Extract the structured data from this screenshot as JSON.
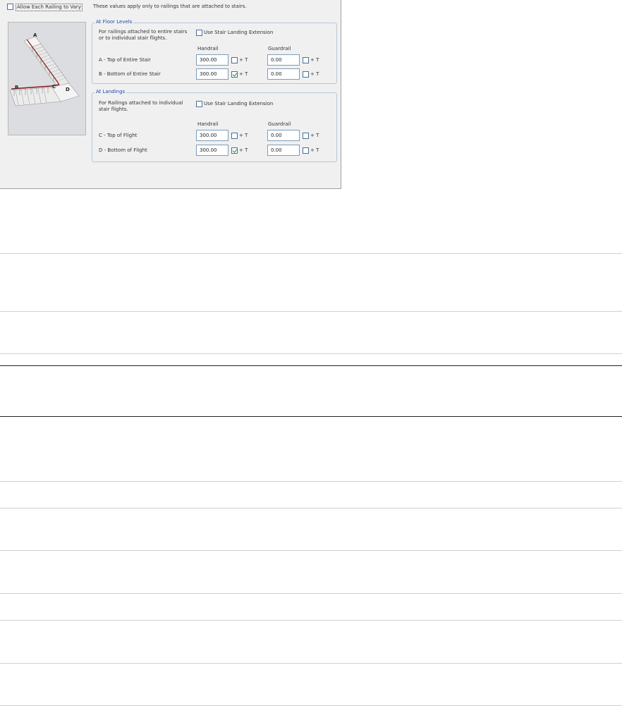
{
  "dialog": {
    "allow_vary_label": "Allow Each Railing to Vary",
    "note": "These values apply only to railings that are attached to stairs.",
    "floor_levels": {
      "title": "At Floor Levels",
      "description": "For railings attached to entire stairs or to individual stair flights.",
      "extension_label": "Use Stair Landing Extension",
      "handrail_header": "Handrail",
      "guardrail_header": "Guardrail",
      "rows": [
        {
          "label": "A - Top of Entire Stair",
          "handrail": "300.00",
          "guardrail": "0.00",
          "handrail_t_checked": false,
          "guardrail_t_checked": false
        },
        {
          "label": "B - Bottom of Entire Stair",
          "handrail": "300.00",
          "guardrail": "0.00",
          "handrail_t_checked": true,
          "guardrail_t_checked": false
        }
      ]
    },
    "landings": {
      "title": "At Landings",
      "description": "For Railings attached to individual stair flights.",
      "extension_label": "Use Stair Landing Extension",
      "handrail_header": "Handrail",
      "guardrail_header": "Guardrail",
      "rows": [
        {
          "label": "C - Top of Flight",
          "handrail": "300.00",
          "guardrail": "0.00",
          "handrail_t_checked": false,
          "guardrail_t_checked": false
        },
        {
          "label": "D - Bottom of Flight",
          "handrail": "300.00",
          "guardrail": "0.00",
          "handrail_t_checked": true,
          "guardrail_t_checked": false
        }
      ]
    },
    "plus_t": "+ T",
    "diagram_letters": [
      "A",
      "B",
      "C",
      "D"
    ]
  },
  "colors": {
    "group_title": "#1f4aa8",
    "dialog_bg": "#f0f0f0",
    "rail": "#8b1a1a"
  }
}
